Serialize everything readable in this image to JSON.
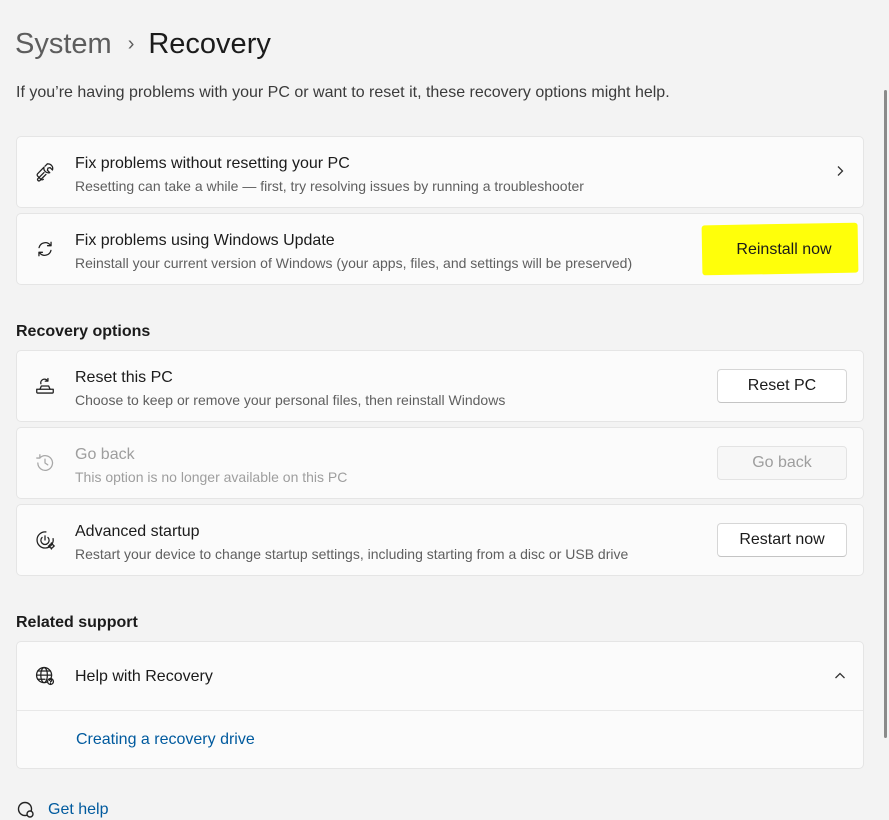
{
  "breadcrumb": {
    "parent": "System",
    "separator": "›",
    "current": "Recovery"
  },
  "intro": "If you’re having problems with your PC or want to reset it, these recovery options might help.",
  "top_cards": [
    {
      "title": "Fix problems without resetting your PC",
      "desc": "Resetting can take a while — first, try resolving issues by running a troubleshooter",
      "icon": "wrench-icon"
    },
    {
      "title": "Fix problems using Windows Update",
      "desc": "Reinstall your current version of Windows (your apps, files, and settings will be preserved)",
      "icon": "sync-icon",
      "button": "Reinstall now",
      "highlight_color": "#ffff0a"
    }
  ],
  "recovery_options": {
    "title": "Recovery options",
    "items": [
      {
        "title": "Reset this PC",
        "desc": "Choose to keep or remove your personal files, then reinstall Windows",
        "icon": "reset-pc-icon",
        "button": "Reset PC"
      },
      {
        "title": "Go back",
        "desc": "This option is no longer available on this PC",
        "icon": "history-icon",
        "button": "Go back",
        "disabled": true
      },
      {
        "title": "Advanced startup",
        "desc": "Restart your device to change startup settings, including starting from a disc or USB drive",
        "icon": "advanced-startup-icon",
        "button": "Restart now"
      }
    ]
  },
  "related_support": {
    "title": "Related support",
    "help_title": "Help with Recovery",
    "help_icon": "globe-icon",
    "link": "Creating a recovery drive"
  },
  "get_help": "Get help",
  "colors": {
    "link": "#005a9e",
    "highlight": "#ffff0a",
    "background": "#f3f3f3",
    "card": "#fbfbfb"
  }
}
